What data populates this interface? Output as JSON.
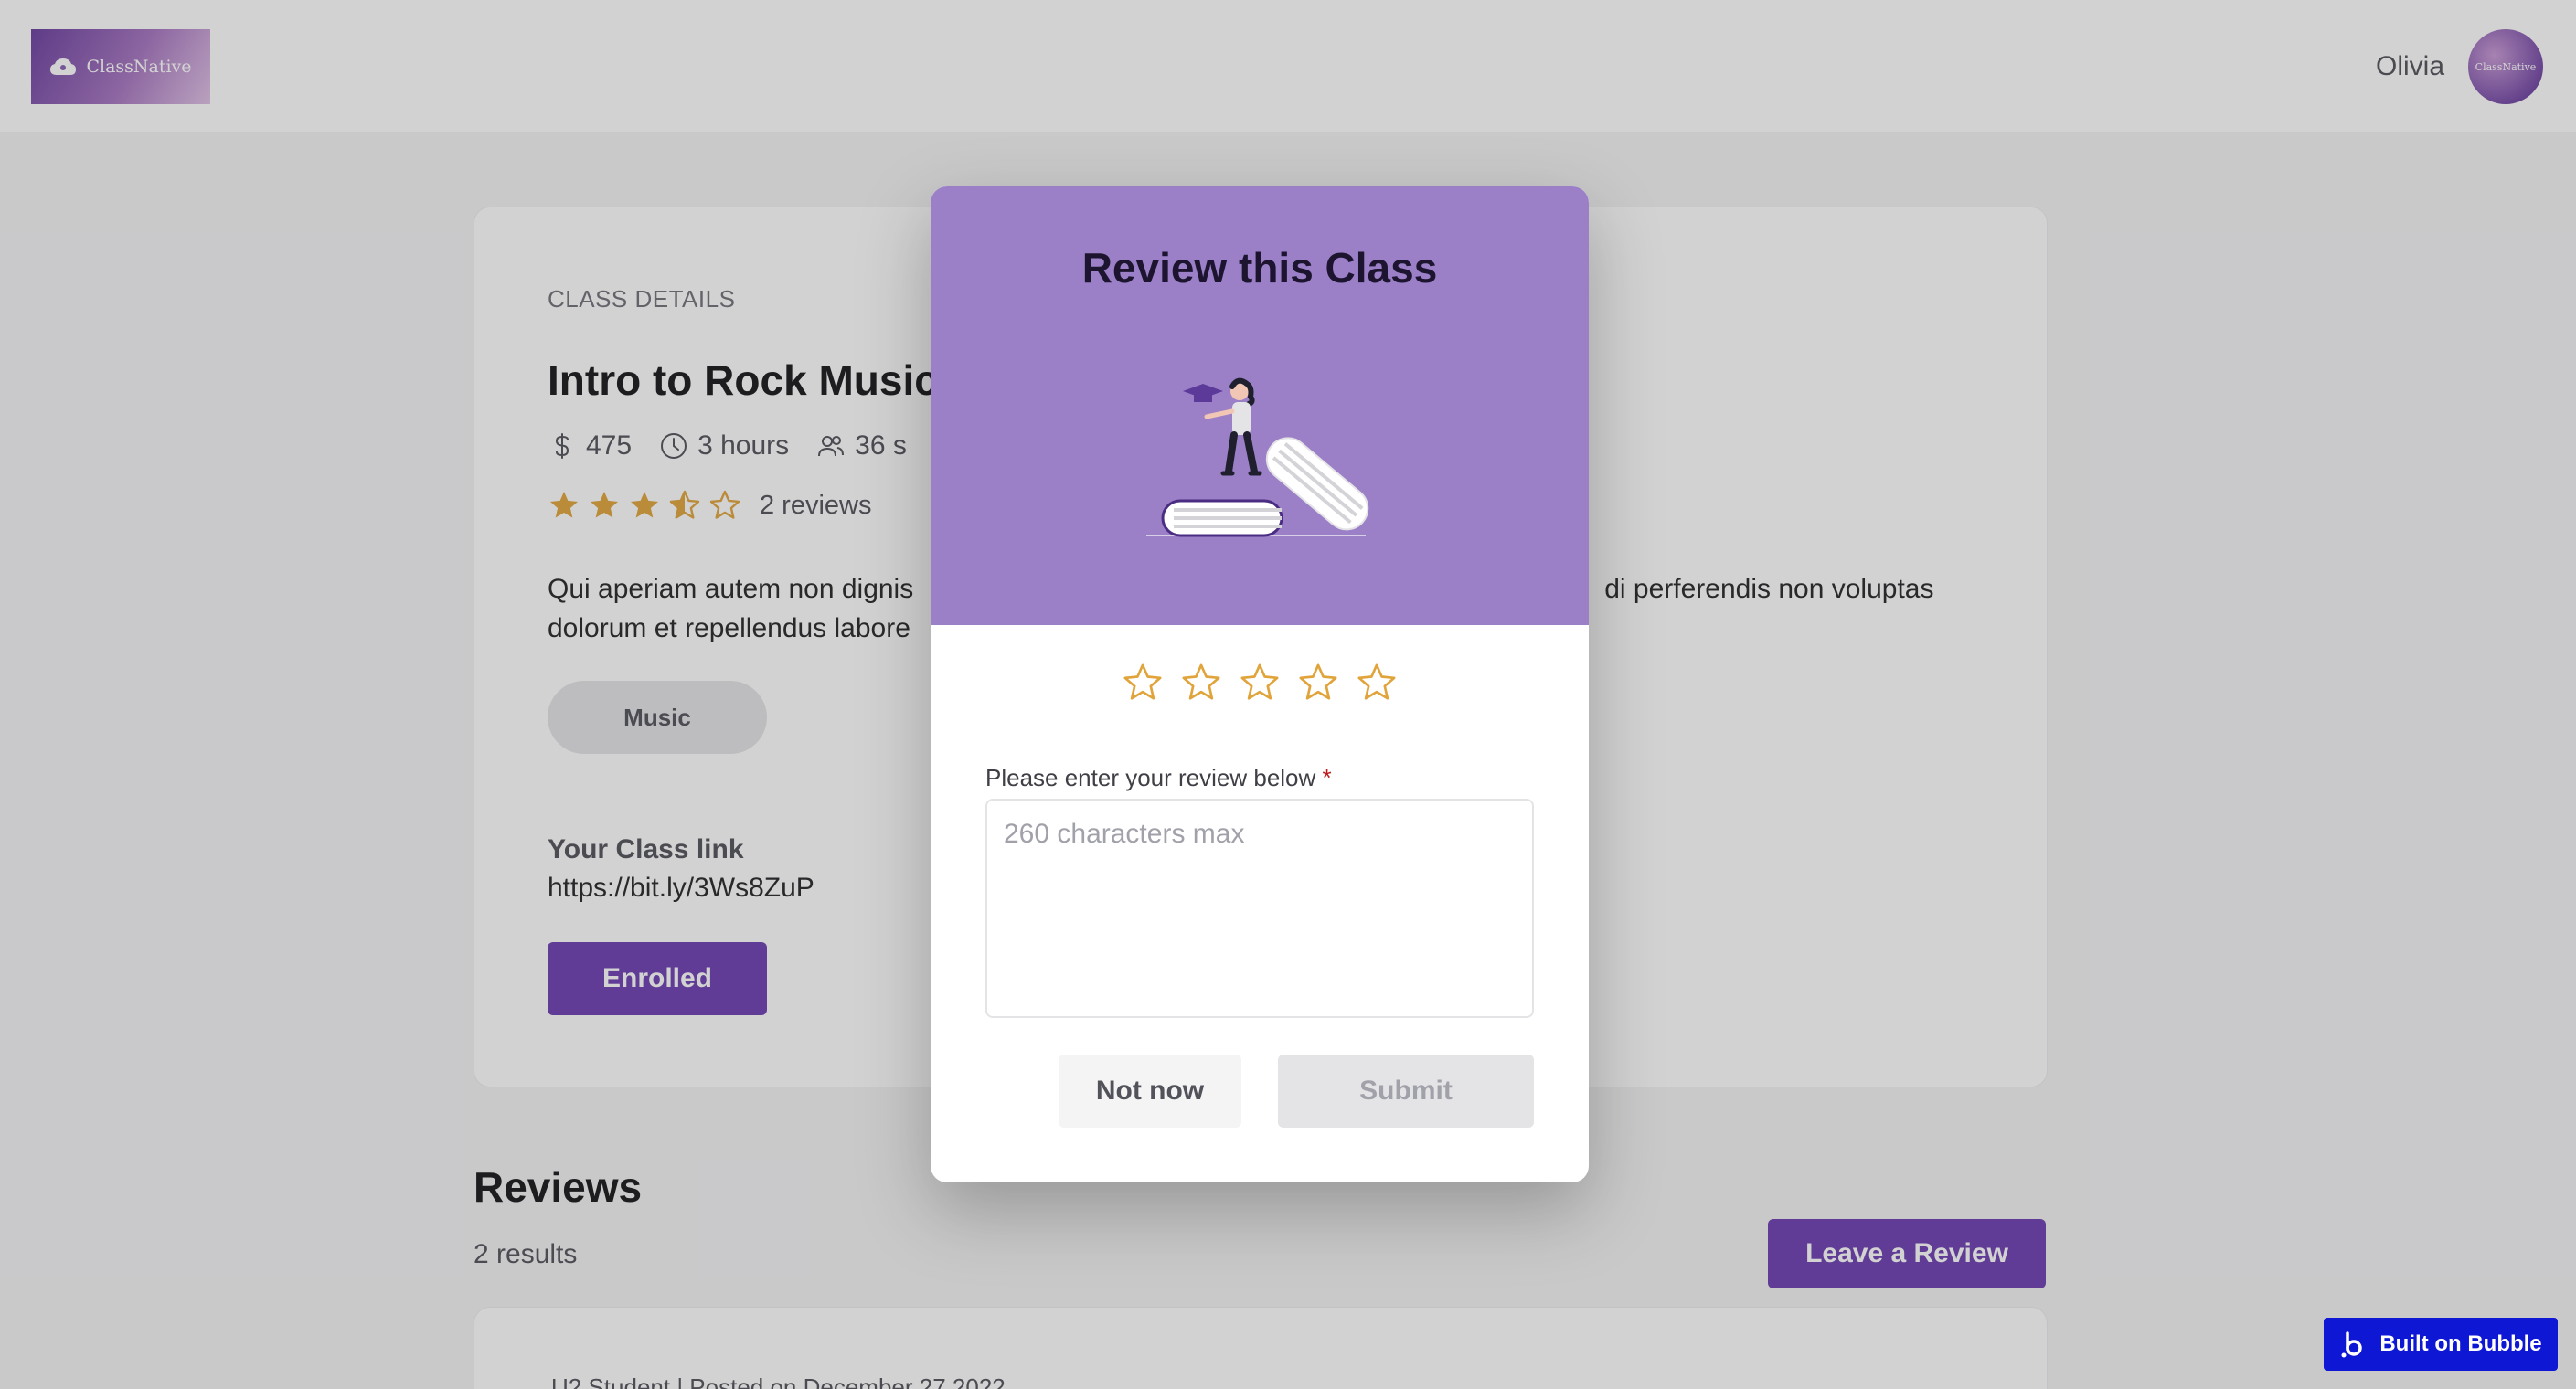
{
  "header": {
    "logo_text": "ClassNative",
    "user_name": "Olivia",
    "avatar_text": "ClassNative"
  },
  "class_card": {
    "eyebrow": "CLASS DETAILS",
    "title": "Intro to Rock Music",
    "price": "475",
    "duration": "3 hours",
    "seats": "36 s",
    "rating": 3.5,
    "rating_max": 5,
    "reviews_count": "2 reviews",
    "description_line1": "Qui aperiam autem non dignis",
    "description_line1_end": "di perferendis non voluptas",
    "description_line2": "dolorum et repellendus labore",
    "tag": "Music",
    "link_label": "Your Class link",
    "link_url": "https://bit.ly/3Ws8ZuP",
    "enrolled_label": "Enrolled"
  },
  "reviews_section": {
    "title": "Reviews",
    "results": "2 results",
    "leave_review_label": "Leave a Review",
    "first_review_meta": "U2 Student  |  Posted on December 27 2022"
  },
  "modal": {
    "title": "Review this Class",
    "stars_selected": 0,
    "stars_max": 5,
    "field_label": "Please enter your review below",
    "required_mark": "*",
    "textarea_placeholder": "260 characters max",
    "textarea_value": "",
    "not_now_label": "Not now",
    "submit_label": "Submit"
  },
  "badge": {
    "label": "Built on Bubble"
  },
  "colors": {
    "brand_purple": "#6d3fb2",
    "modal_header": "#9b80c8",
    "star_gold": "#e0a43a",
    "badge_blue": "#0e17d4"
  }
}
